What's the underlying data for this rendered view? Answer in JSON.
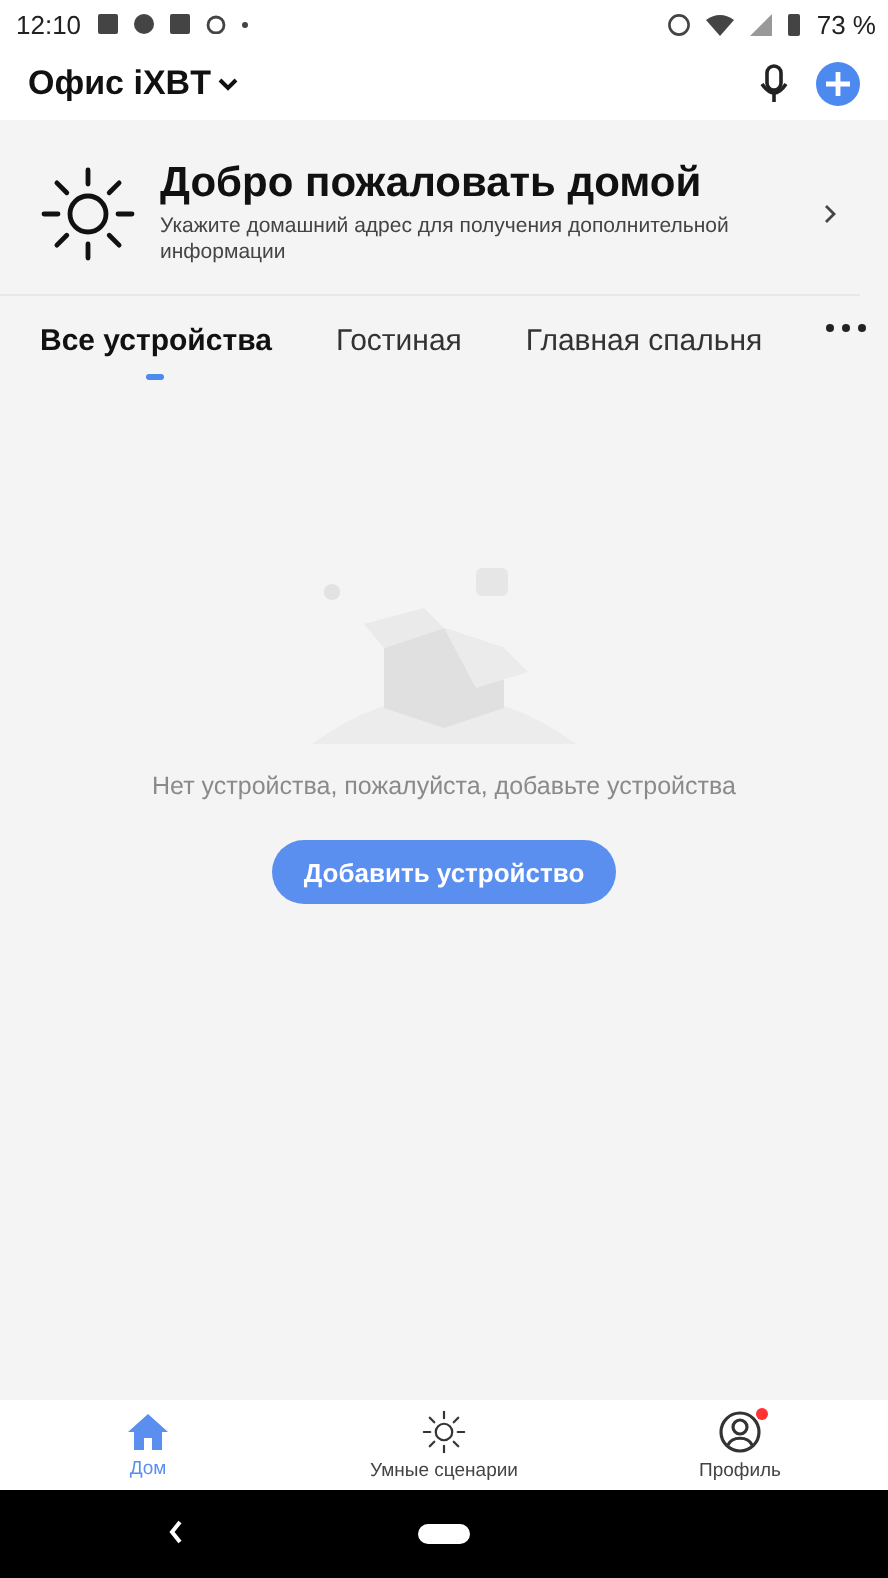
{
  "status_bar": {
    "time": "12:10",
    "battery": "73 %"
  },
  "header": {
    "home_name": "Офис iXBT"
  },
  "welcome": {
    "title": "Добро пожаловать домой",
    "subtitle": "Укажите домашний адрес для получения дополнительной информации"
  },
  "tabs": [
    {
      "label": "Все устройства",
      "selected": true
    },
    {
      "label": "Гостиная",
      "selected": false
    },
    {
      "label": "Главная спальня",
      "selected": false
    }
  ],
  "empty_state": {
    "message": "Нет устройства, пожалуйста, добавьте устройства",
    "button": "Добавить устройство"
  },
  "bottom_nav": [
    {
      "kind": "home",
      "label": "Дом",
      "selected": true,
      "badge": false
    },
    {
      "kind": "scenes",
      "label": "Умные сценарии",
      "selected": false,
      "badge": false
    },
    {
      "kind": "profile",
      "label": "Профиль",
      "selected": false,
      "badge": true
    }
  ]
}
